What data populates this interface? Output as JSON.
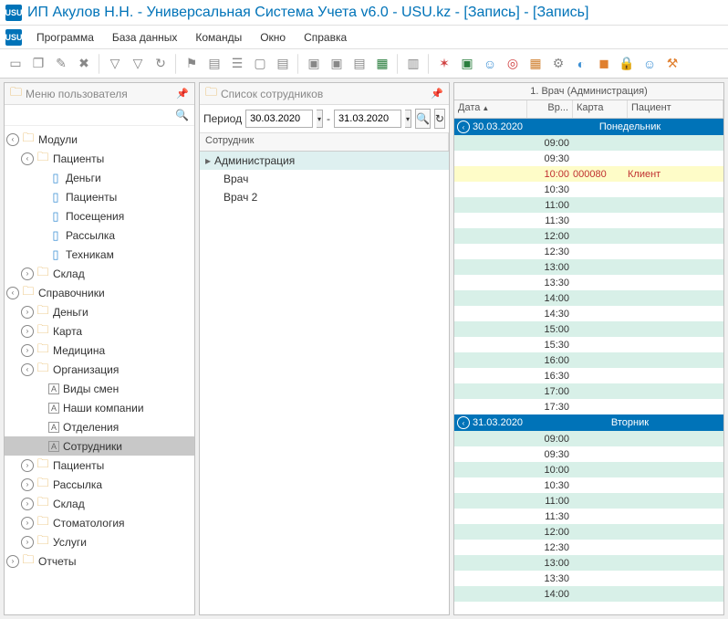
{
  "window": {
    "icon_text": "USU",
    "title": "ИП Акулов Н.Н. - Универсальная Система Учета v6.0 - USU.kz - [Запись] - [Запись]"
  },
  "menubar": [
    "Программа",
    "База данных",
    "Команды",
    "Окно",
    "Справка"
  ],
  "panels": {
    "left_title": "Меню пользователя",
    "mid_title": "Список сотрудников",
    "right_title": "1. Врач (Администрация)"
  },
  "tree": {
    "modules": {
      "label": "Модули",
      "patients": {
        "label": "Пациенты",
        "children": [
          "Деньги",
          "Пациенты",
          "Посещения",
          "Рассылка",
          "Техникам"
        ]
      },
      "warehouse": "Склад"
    },
    "directories": {
      "label": "Справочники",
      "children": [
        "Деньги",
        "Карта",
        "Медицина"
      ],
      "organization": {
        "label": "Организация",
        "children": [
          "Виды смен",
          "Наши компании",
          "Отделения",
          "Сотрудники"
        ]
      },
      "tail": [
        "Пациенты",
        "Рассылка",
        "Склад",
        "Стоматология",
        "Услуги"
      ]
    },
    "reports": "Отчеты"
  },
  "period": {
    "label": "Период",
    "from": "30.03.2020",
    "to": "31.03.2020",
    "sep": "-"
  },
  "employees": {
    "header": "Сотрудник",
    "group": "Администрация",
    "list": [
      "Врач",
      "Врач 2"
    ]
  },
  "schedule": {
    "headers": {
      "date": "Дата",
      "time": "Вр...",
      "card": "Карта",
      "patient": "Пациент"
    },
    "days": [
      {
        "date": "30.03.2020",
        "dow": "Понедельник",
        "slots": [
          {
            "t": "09:00"
          },
          {
            "t": "09:30"
          },
          {
            "t": "10:00",
            "card": "000080",
            "patient": "Клиент"
          },
          {
            "t": "10:30"
          },
          {
            "t": "11:00"
          },
          {
            "t": "11:30"
          },
          {
            "t": "12:00"
          },
          {
            "t": "12:30"
          },
          {
            "t": "13:00"
          },
          {
            "t": "13:30"
          },
          {
            "t": "14:00"
          },
          {
            "t": "14:30"
          },
          {
            "t": "15:00"
          },
          {
            "t": "15:30"
          },
          {
            "t": "16:00"
          },
          {
            "t": "16:30"
          },
          {
            "t": "17:00"
          },
          {
            "t": "17:30"
          }
        ]
      },
      {
        "date": "31.03.2020",
        "dow": "Вторник",
        "slots": [
          {
            "t": "09:00"
          },
          {
            "t": "09:30"
          },
          {
            "t": "10:00"
          },
          {
            "t": "10:30"
          },
          {
            "t": "11:00"
          },
          {
            "t": "11:30"
          },
          {
            "t": "12:00"
          },
          {
            "t": "12:30"
          },
          {
            "t": "13:00"
          },
          {
            "t": "13:30"
          },
          {
            "t": "14:00"
          }
        ]
      }
    ]
  }
}
